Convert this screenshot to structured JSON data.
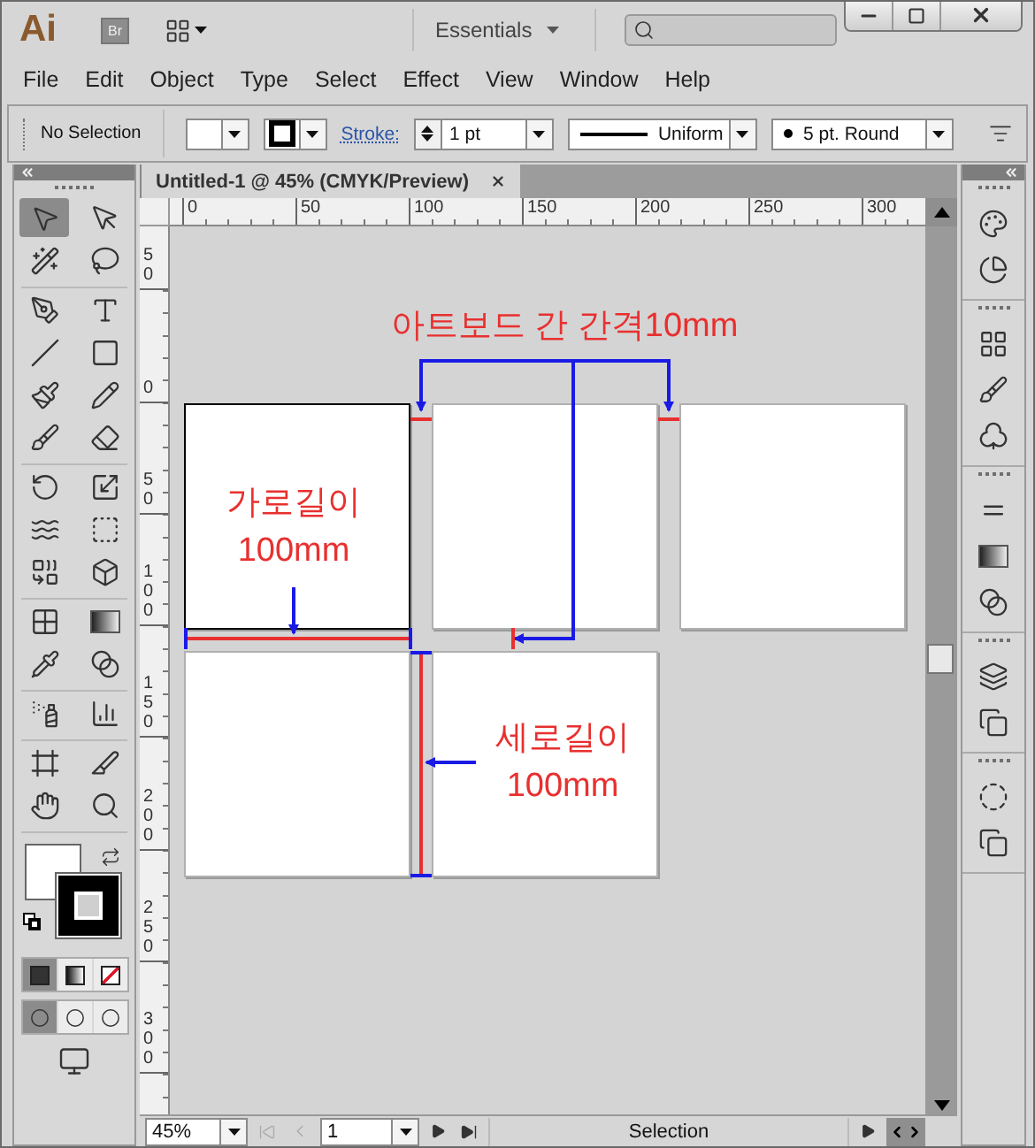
{
  "app": {
    "logo": "Ai",
    "bridge": "Br",
    "workspace": "Essentials"
  },
  "menu": [
    "File",
    "Edit",
    "Object",
    "Type",
    "Select",
    "Effect",
    "View",
    "Window",
    "Help"
  ],
  "control_bar": {
    "selection": "No Selection",
    "stroke_label": "Stroke:",
    "stroke_weight": "1 pt",
    "profile": "Uniform",
    "brush": "5 pt. Round"
  },
  "tool_groups": [
    [
      {
        "kind": "selection",
        "selected": true
      },
      {
        "kind": "direct",
        "selected": false
      },
      {
        "kind": "magic",
        "selected": false
      },
      {
        "kind": "lasso",
        "selected": false
      }
    ],
    [
      {
        "kind": "pen",
        "selected": false
      },
      {
        "kind": "type",
        "selected": false
      },
      {
        "kind": "line",
        "selected": false
      },
      {
        "kind": "rect",
        "selected": false
      },
      {
        "kind": "paintbrush",
        "selected": false
      },
      {
        "kind": "pencil",
        "selected": false
      },
      {
        "kind": "blob",
        "selected": false
      },
      {
        "kind": "eraser",
        "selected": false
      }
    ],
    [
      {
        "kind": "rotate",
        "selected": false
      },
      {
        "kind": "scale",
        "selected": false
      },
      {
        "kind": "warp",
        "selected": false
      },
      {
        "kind": "free",
        "selected": false
      },
      {
        "kind": "shape",
        "selected": false
      },
      {
        "kind": "perspective",
        "selected": false
      }
    ],
    [
      {
        "kind": "mesh",
        "selected": false
      },
      {
        "kind": "gradient",
        "selected": false
      },
      {
        "kind": "eyedropper",
        "selected": false
      },
      {
        "kind": "blend",
        "selected": false
      }
    ],
    [
      {
        "kind": "sprayer",
        "selected": false
      },
      {
        "kind": "graph",
        "selected": false
      }
    ],
    [
      {
        "kind": "artboard",
        "selected": false
      },
      {
        "kind": "slice",
        "selected": false
      },
      {
        "kind": "hand",
        "selected": false
      },
      {
        "kind": "zoom",
        "selected": false
      }
    ]
  ],
  "color_modes": [
    {
      "kind": "color",
      "selected": true
    },
    {
      "kind": "gradient",
      "selected": false
    },
    {
      "kind": "none",
      "selected": false
    }
  ],
  "draw_modes": [
    {
      "selected": true
    },
    {
      "selected": false
    },
    {
      "selected": false
    }
  ],
  "document_tab": {
    "title": "Untitled-1 @ 45% (CMYK/Preview)"
  },
  "rulers": {
    "horizontal": [
      "0",
      "50",
      "100",
      "150",
      "200",
      "250",
      "300"
    ],
    "vertical": [
      "50",
      "0",
      "50",
      "100",
      "150",
      "200",
      "250",
      "300"
    ]
  },
  "artboards": [
    {
      "selected": true
    },
    {
      "selected": false
    },
    {
      "selected": false
    },
    {
      "selected": false
    },
    {
      "selected": false
    }
  ],
  "annotations": {
    "spacing": "아트보드 간 간격10mm",
    "width": "가로길이\n100mm",
    "height": "세로길이\n100mm"
  },
  "status_bar": {
    "zoom": "45%",
    "artboard": "1",
    "tool": "Selection"
  }
}
